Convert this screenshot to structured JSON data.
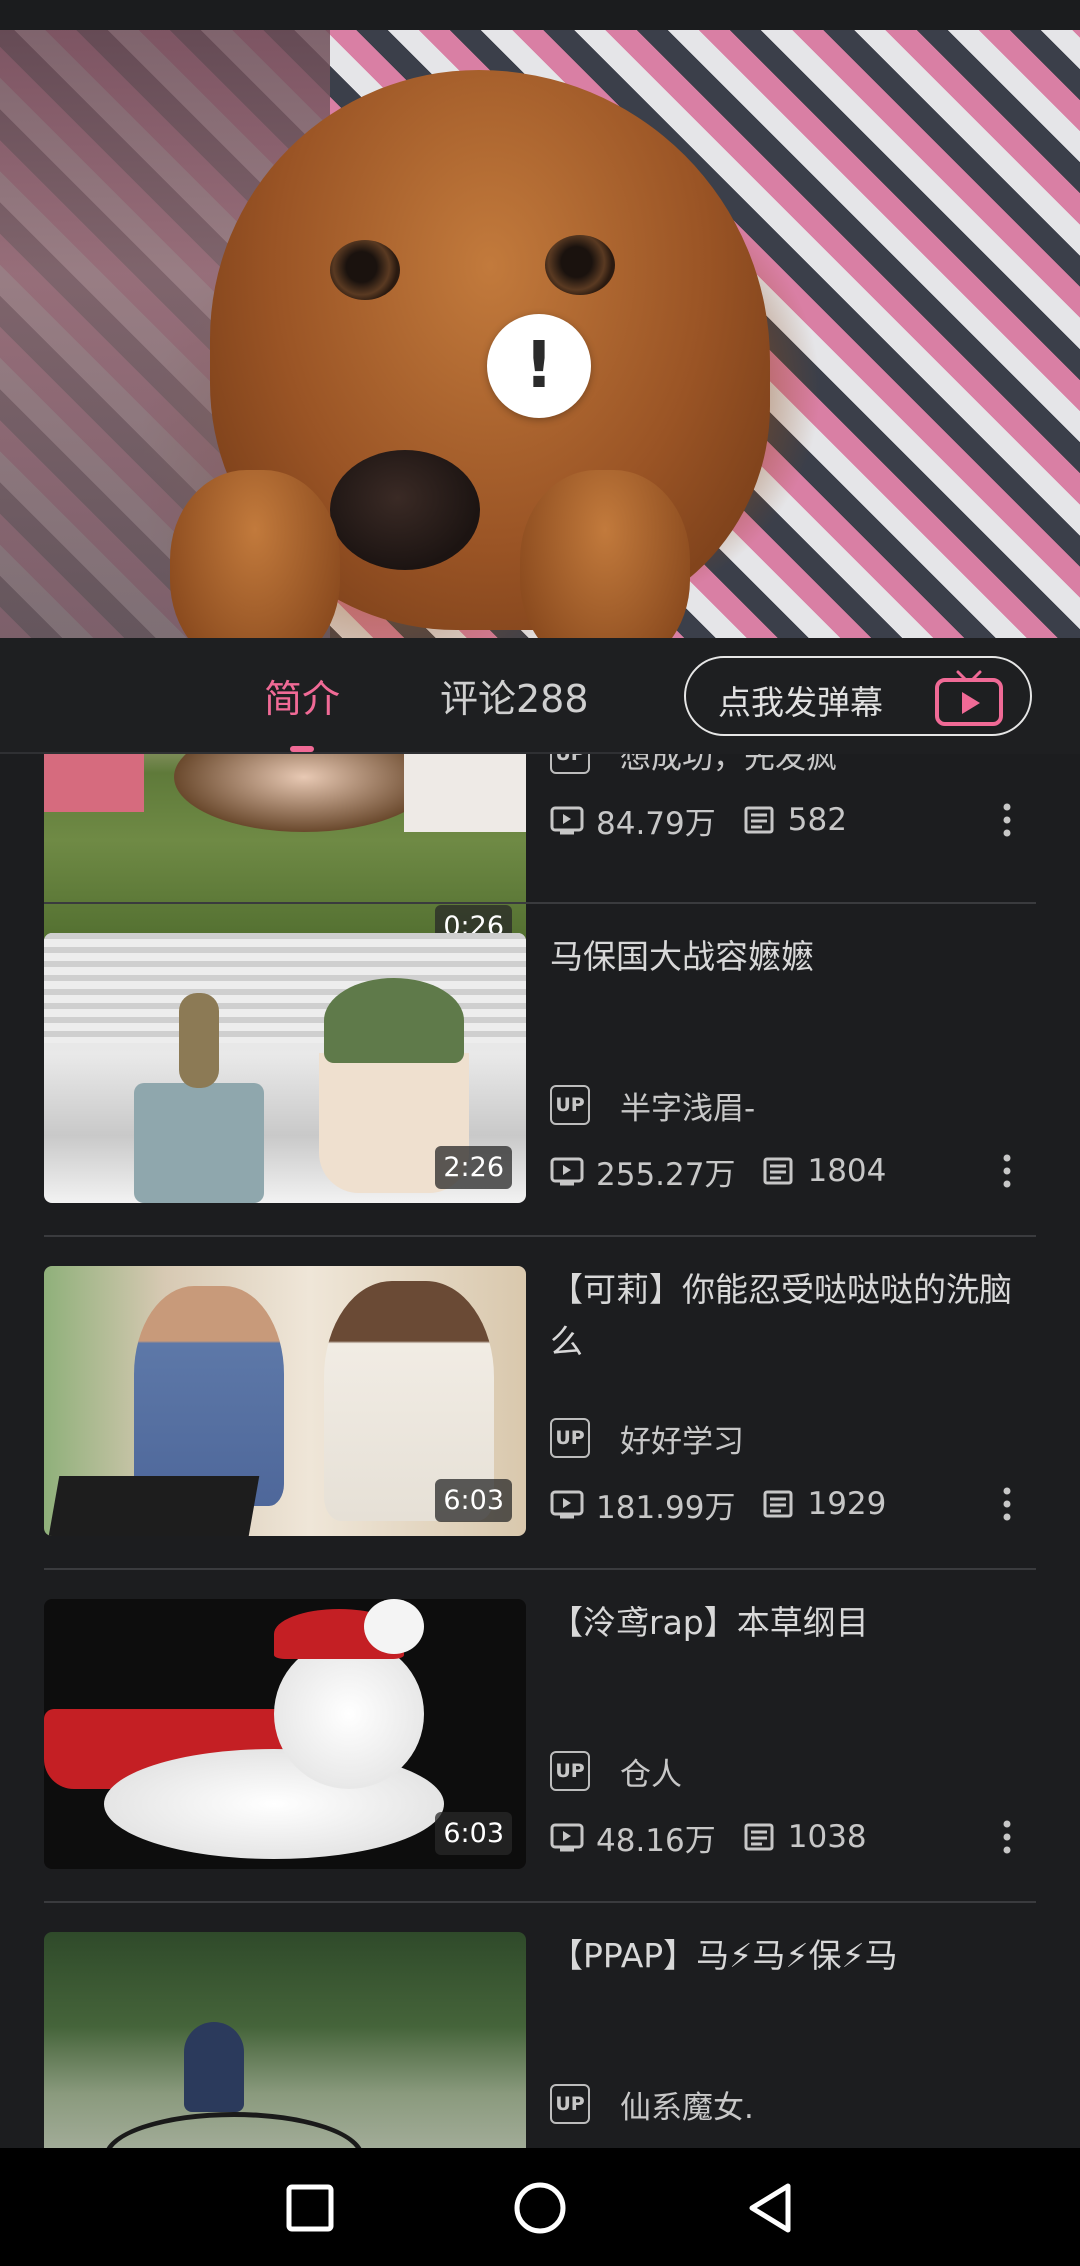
{
  "tabs": [
    {
      "label": "简介",
      "active": true
    },
    {
      "label": "评论288",
      "active": false
    }
  ],
  "danmu_button": {
    "label": "点我发弹幕",
    "icon": "tv-icon"
  },
  "accent_color": "#f06a96",
  "videos": [
    {
      "title": "",
      "uploader": "想成功，先发疯",
      "views": "84.79万",
      "danmaku": "582",
      "duration": "0:26",
      "thumb": "couple-lying-on-grass"
    },
    {
      "title": "马保国大战容嬷嬷",
      "uploader": "半字浅眉-",
      "views": "255.27万",
      "danmaku": "1804",
      "duration": "2:26",
      "thumb": "cactus-mugs"
    },
    {
      "title": "【可莉】你能忍受哒哒哒的洗脑么",
      "uploader": "好好学习",
      "views": "181.99万",
      "danmaku": "1929",
      "duration": "6:03",
      "thumb": "two-men-laptop"
    },
    {
      "title": "【泠鸢rap】本草纲目",
      "uploader": "仓人",
      "views": "48.16万",
      "danmaku": "1038",
      "duration": "6:03",
      "thumb": "white-cat-santa-hat"
    },
    {
      "title": "【PPAP】马⚡马⚡保⚡马",
      "uploader": "仙系魔女.",
      "views": "",
      "danmaku": "",
      "duration": "",
      "thumb": "man-on-bicycle"
    }
  ],
  "up_badge": "UP",
  "alert_icon": "!",
  "nav": [
    "recent-apps-icon",
    "home-icon",
    "back-icon"
  ]
}
